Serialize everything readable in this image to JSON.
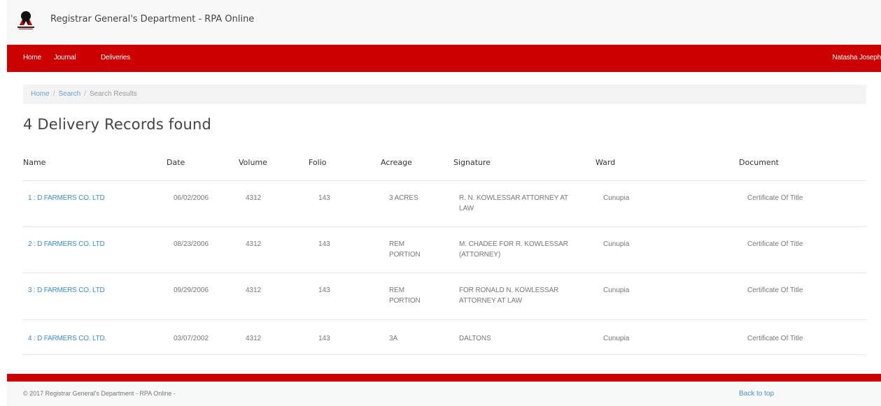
{
  "header": {
    "site_title": "Registrar General's Department - RPA Online"
  },
  "nav": {
    "items": [
      {
        "label": "Home"
      },
      {
        "label": "Journal"
      },
      {
        "label": "Deliveries"
      }
    ],
    "user": "Natasha Joseph"
  },
  "breadcrumb": {
    "home": "Home",
    "search": "Search",
    "current": "Search Results"
  },
  "heading": "4 Delivery Records found",
  "table": {
    "columns": [
      "Name",
      "Date",
      "Volume",
      "Folio",
      "Acreage",
      "Signature",
      "Ward",
      "Document"
    ],
    "rows": [
      {
        "name": "1 : D FARMERS CO. LTD",
        "date": "06/02/2006",
        "volume": "4312",
        "folio": "143",
        "acreage_1": "3 ACRES",
        "acreage_2": "",
        "signature_1": "R. N. KOWLESSAR ATTORNEY AT",
        "signature_2": "LAW",
        "ward": "Cunupia",
        "document": "Certificate Of Title"
      },
      {
        "name": "2 : D FARMERS CO. LTD",
        "date": "08/23/2006",
        "volume": "4312",
        "folio": "143",
        "acreage_1": "REM",
        "acreage_2": "PORTION",
        "signature_1": "M. CHADEE FOR R. KOWLESSAR",
        "signature_2": "(ATTORNEY)",
        "ward": "Cunupia",
        "document": "Certificate Of Title"
      },
      {
        "name": "3 : D FARMERS CO. LTD",
        "date": "09/29/2006",
        "volume": "4312",
        "folio": "143",
        "acreage_1": "REM",
        "acreage_2": "PORTION",
        "signature_1": "FOR RONALD N. KOWLESSAR",
        "signature_2": "ATTORNEY AT LAW",
        "ward": "Cunupia",
        "document": "Certificate Of Title"
      },
      {
        "name": "4 : D FARMERS CO. LTD.",
        "date": "03/07/2002",
        "volume": "4312",
        "folio": "143",
        "acreage_1": "3A",
        "acreage_2": "",
        "signature_1": "DALTONS",
        "signature_2": "",
        "ward": "Cunupia",
        "document": "Certificate Of Title"
      }
    ]
  },
  "footer": {
    "copyright": "© 2017 Registrar General's Department - RPA Online -",
    "back_to_top": "Back to top"
  },
  "colors": {
    "brand_red": "#cc0000",
    "link_blue": "#3c8ecf"
  }
}
